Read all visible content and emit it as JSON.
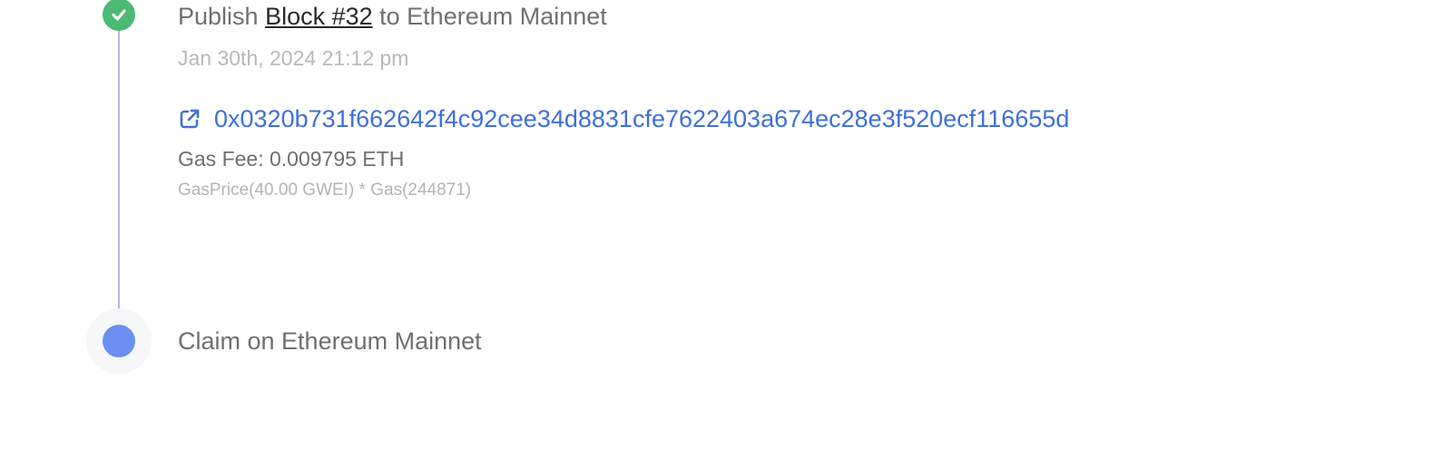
{
  "steps": [
    {
      "status": "complete",
      "icon": "check-icon",
      "title_prefix": "Publish ",
      "title_link": "Block #32",
      "title_suffix": " to Ethereum Mainnet",
      "timestamp": "Jan 30th, 2024 21:12 pm",
      "tx_hash": "0x0320b731f662642f4c92cee34d8831cfe7622403a674ec28e3f520ecf116655d",
      "tx_icon": "external-link-icon",
      "gas_fee": "Gas Fee: 0.009795 ETH",
      "gas_detail": "GasPrice(40.00 GWEI) * Gas(244871)"
    },
    {
      "status": "pending",
      "title": "Claim on Ethereum Mainnet"
    }
  ],
  "colors": {
    "complete": "#4cba74",
    "pending": "#6b8ff0",
    "link": "#3f6fd8",
    "connector": "#b3b5e6"
  }
}
